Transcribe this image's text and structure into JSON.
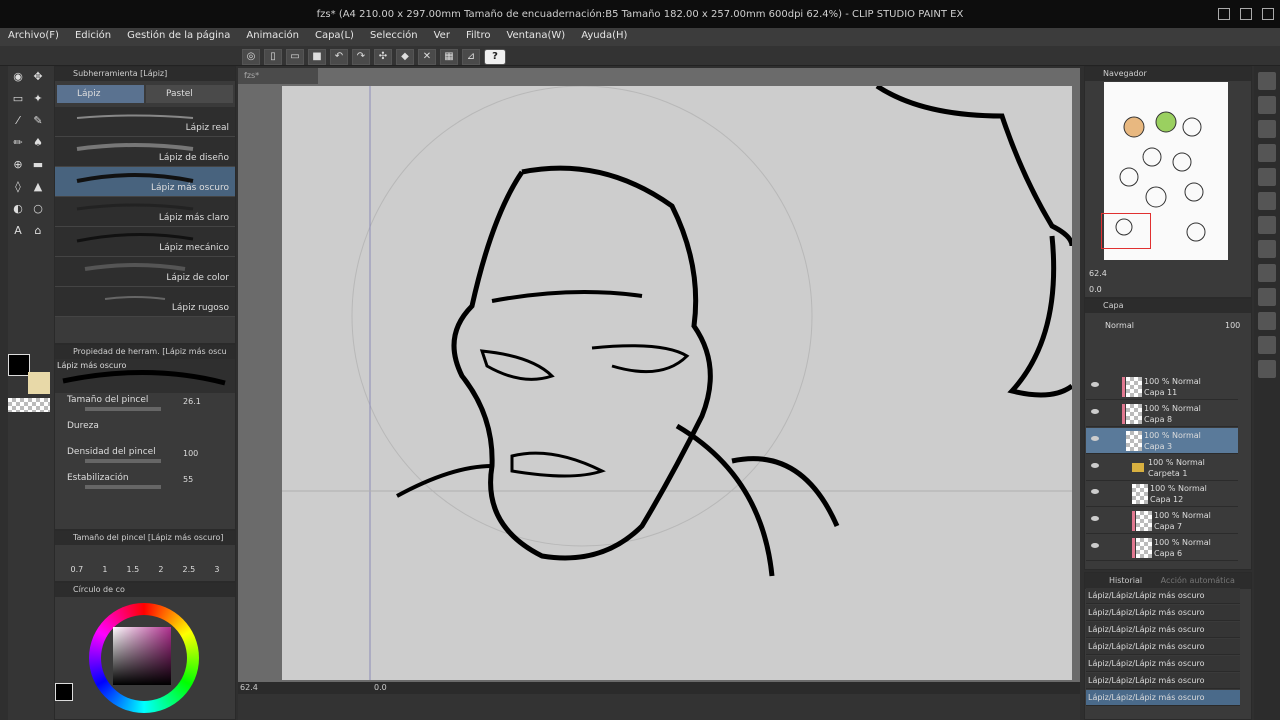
{
  "window": {
    "title": "fzs* (A4 210.00 x 297.00mm Tamaño de encuadernación:B5 Tamaño 182.00 x 257.00mm 600dpi 62.4%) - CLIP STUDIO PAINT EX"
  },
  "menu": [
    "Archivo(F)",
    "Edición",
    "Gestión de la página",
    "Animación",
    "Capa(L)",
    "Selección",
    "Ver",
    "Filtro",
    "Ventana(W)",
    "Ayuda(H)"
  ],
  "subtool_panel": {
    "header": "Subherramienta [Lápiz]",
    "tabs": [
      "Lápiz",
      "Pastel"
    ],
    "brushes": [
      "Lápiz real",
      "Lápiz de diseño",
      "Lápiz más oscuro",
      "Lápiz más claro",
      "Lápiz mecánico",
      "Lápiz de color",
      "Lápiz rugoso"
    ],
    "selected_brush": "Lápiz más oscuro"
  },
  "tool_property": {
    "header": "Propiedad de herram. [Lápiz más oscu",
    "brush_name": "Lápiz más oscuro",
    "brush_size_label": "Tamaño del pincel",
    "brush_size_value": "26.1",
    "hardness_label": "Dureza",
    "density_label": "Densidad del pincel",
    "density_value": "100",
    "stabilization_label": "Estabilización",
    "stabilization_value": "55"
  },
  "brush_size_panel": {
    "header": "Tamaño del pincel [Lápiz más oscuro]",
    "sizes": [
      "0.7",
      "1",
      "1.5",
      "2",
      "2.5",
      "3"
    ]
  },
  "color_panel": {
    "header": "Círculo de co",
    "main_color": "#000000",
    "sub_color": "#e8d9a8"
  },
  "canvas": {
    "doc_tab": "fzs*",
    "zoom": "62.4",
    "rotation": "0.0"
  },
  "navigator": {
    "header": "Navegador",
    "zoom": "62.4",
    "angle": "0.0"
  },
  "layers": {
    "header": "Capa",
    "blend_mode": "Normal",
    "opacity": "100",
    "items": [
      {
        "line1": "100 % Normal",
        "line2": "Capa 11",
        "selected": false
      },
      {
        "line1": "100 % Normal",
        "line2": "Capa 8",
        "selected": false
      },
      {
        "line1": "100 % Normal",
        "line2": "Capa 3",
        "selected": true
      },
      {
        "line1": "100 % Normal",
        "line2": "Carpeta 1",
        "selected": false
      },
      {
        "line1": "100 % Normal",
        "line2": "Capa 12",
        "selected": false
      },
      {
        "line1": "100 % Normal",
        "line2": "Capa 7",
        "selected": false
      },
      {
        "line1": "100 % Normal",
        "line2": "Capa 6",
        "selected": false
      }
    ]
  },
  "history": {
    "tabs": [
      "Historial",
      "Acción automática"
    ],
    "items": [
      "Lápiz/Lápiz/Lápiz más oscuro",
      "Lápiz/Lápiz/Lápiz más oscuro",
      "Lápiz/Lápiz/Lápiz más oscuro",
      "Lápiz/Lápiz/Lápiz más oscuro",
      "Lápiz/Lápiz/Lápiz más oscuro",
      "Lápiz/Lápiz/Lápiz más oscuro",
      "Lápiz/Lápiz/Lápiz más oscuro"
    ]
  }
}
